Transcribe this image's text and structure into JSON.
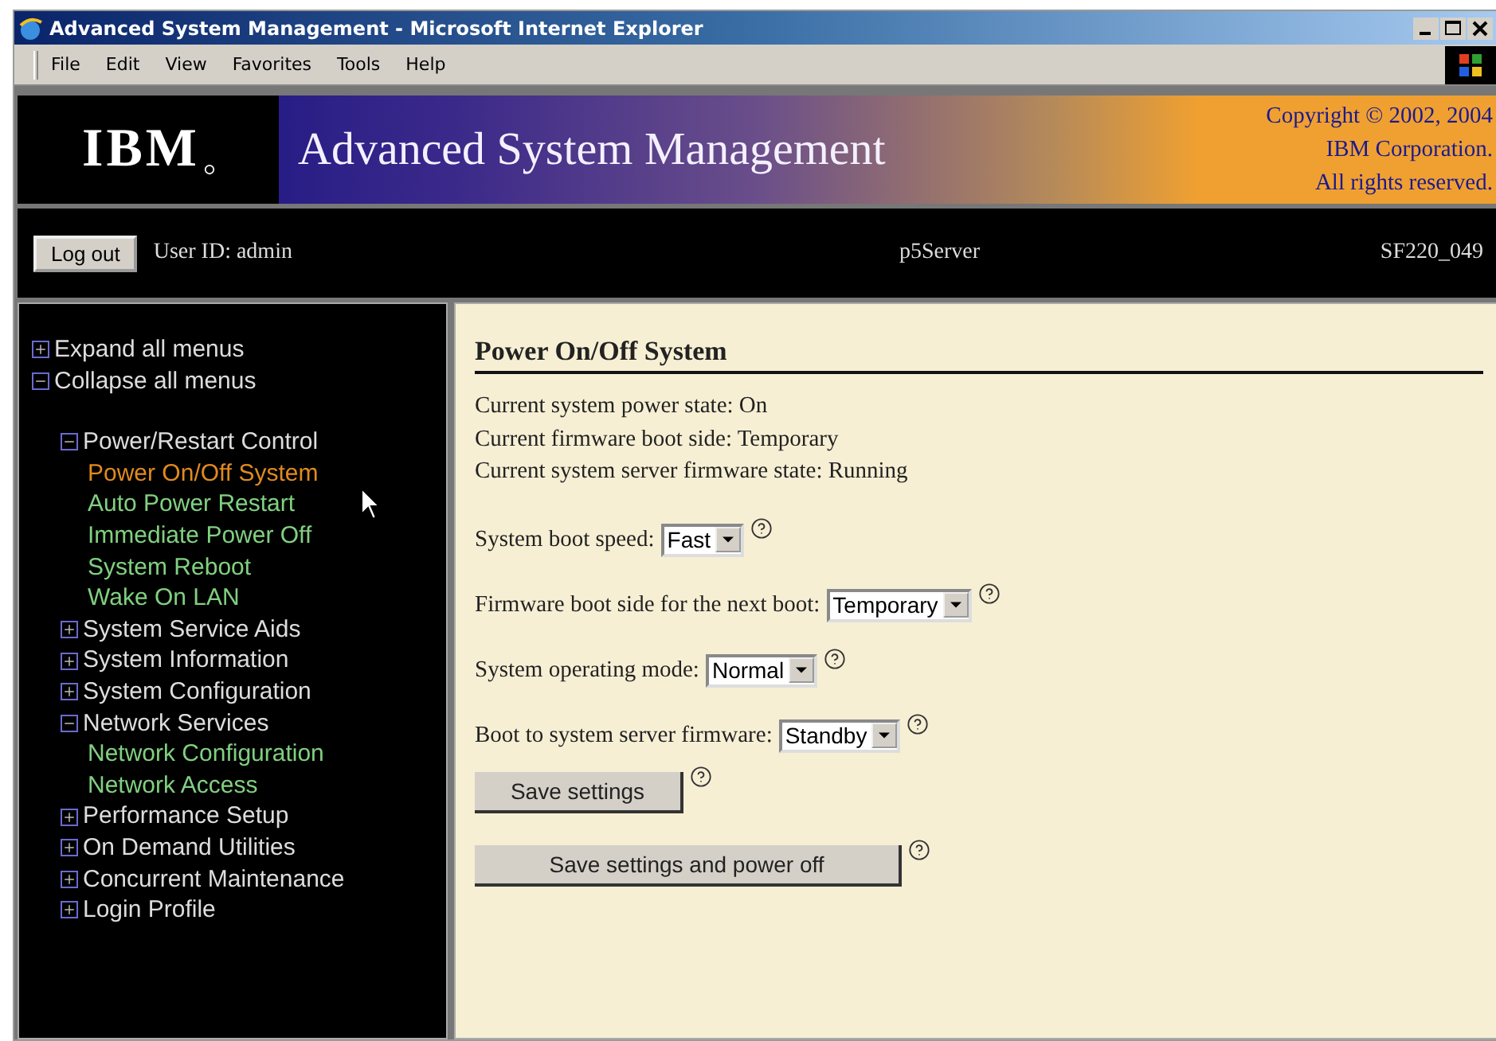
{
  "window": {
    "title": "Advanced System Management - Microsoft Internet Explorer"
  },
  "menu_bar": [
    "File",
    "Edit",
    "View",
    "Favorites",
    "Tools",
    "Help"
  ],
  "banner": {
    "logo": "IBM",
    "title": "Advanced System Management",
    "copyright": [
      "Copyright © 2002, 2004",
      "IBM Corporation.",
      "All rights reserved."
    ]
  },
  "session_bar": {
    "logout": "Log out",
    "user": "User ID: admin",
    "server": "p5Server",
    "firmware": "SF220_049"
  },
  "sidebar": {
    "actions": [
      {
        "label": "Expand all menus",
        "expanded": false
      },
      {
        "label": "Collapse all menus",
        "expanded": true
      }
    ],
    "sections": [
      {
        "label": "Power/Restart Control",
        "expanded": true,
        "children": [
          {
            "label": "Power On/Off System",
            "selected": true
          },
          {
            "label": "Auto Power Restart",
            "selected": false
          },
          {
            "label": "Immediate Power Off",
            "selected": false
          },
          {
            "label": "System Reboot",
            "selected": false
          },
          {
            "label": "Wake On LAN",
            "selected": false
          }
        ]
      },
      {
        "label": "System Service Aids",
        "expanded": false
      },
      {
        "label": "System Information",
        "expanded": false
      },
      {
        "label": "System Configuration",
        "expanded": false
      },
      {
        "label": "Network Services",
        "expanded": true,
        "children": [
          {
            "label": "Network Configuration",
            "selected": false
          },
          {
            "label": "Network Access",
            "selected": false
          }
        ]
      },
      {
        "label": "Performance Setup",
        "expanded": false
      },
      {
        "label": "On Demand Utilities",
        "expanded": false
      },
      {
        "label": "Concurrent Maintenance",
        "expanded": false
      },
      {
        "label": "Login Profile",
        "expanded": false
      }
    ]
  },
  "content": {
    "heading": "Power On/Off System",
    "status_lines": [
      "Current system power state: On",
      "Current firmware boot side: Temporary",
      "Current system server firmware state: Running"
    ],
    "settings": [
      {
        "label": "System boot speed:",
        "value": "Fast"
      },
      {
        "label": "Firmware boot side for the next boot:",
        "value": "Temporary"
      },
      {
        "label": "System operating mode:",
        "value": "Normal"
      },
      {
        "label": "Boot to system server firmware:",
        "value": "Standby"
      }
    ],
    "buttons": [
      {
        "label": "Save settings"
      },
      {
        "label": "Save settings and power off"
      }
    ]
  }
}
